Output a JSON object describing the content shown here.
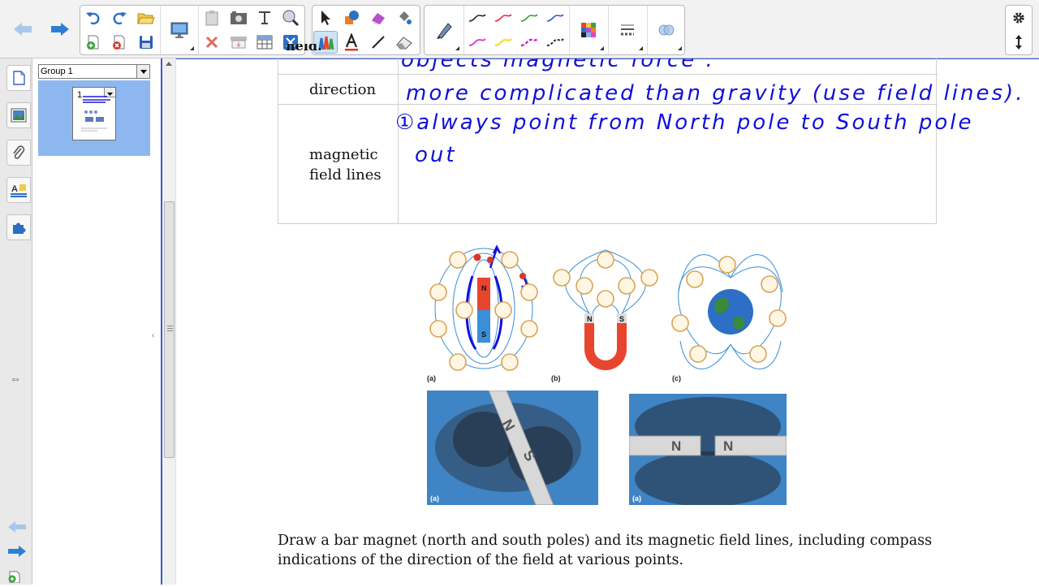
{
  "toolbar": {
    "groups": [
      "navigation",
      "file-edit",
      "drawing-tools",
      "pens",
      "properties"
    ],
    "settings_icon": "gear-icon",
    "expand_icon": "up-down-arrow-icon"
  },
  "sorter": {
    "group_name": "Group 1",
    "page_number": "1"
  },
  "sidetabs": [
    "page-sorter-icon",
    "gallery-icon",
    "attachments-icon",
    "properties-icon",
    "addons-icon"
  ],
  "table": {
    "rows": [
      {
        "label": "field.",
        "note": "objects magnetic force ."
      },
      {
        "label": "direction",
        "note": "more complicated than gravity (use field lines)."
      },
      {
        "label_lines": [
          "magnetic",
          "field lines"
        ],
        "note_lines": [
          "①always point from North pole to South pole",
          "out"
        ]
      }
    ]
  },
  "figures": {
    "diagram_labels": [
      "(a)",
      "(b)",
      "(c)"
    ],
    "bar_magnet_labels": [
      "N",
      "S"
    ],
    "horseshoe_labels": [
      "N",
      "S"
    ],
    "photo1_label": "(a)",
    "photo1_poles": [
      "N",
      "S"
    ],
    "photo2_label": "(a)",
    "photo2_poles": [
      "N",
      "N"
    ]
  },
  "instructions": {
    "line1": "Draw a bar magnet (north and south poles) and its magnetic field lines, including compass",
    "line2": "indications of the direction of the field at various points."
  },
  "colors": {
    "ink_blue": "#1010d8",
    "selection_blue": "#3c5bd0",
    "magnet_red": "#e8452f",
    "magnet_blue": "#3a8fd8"
  }
}
